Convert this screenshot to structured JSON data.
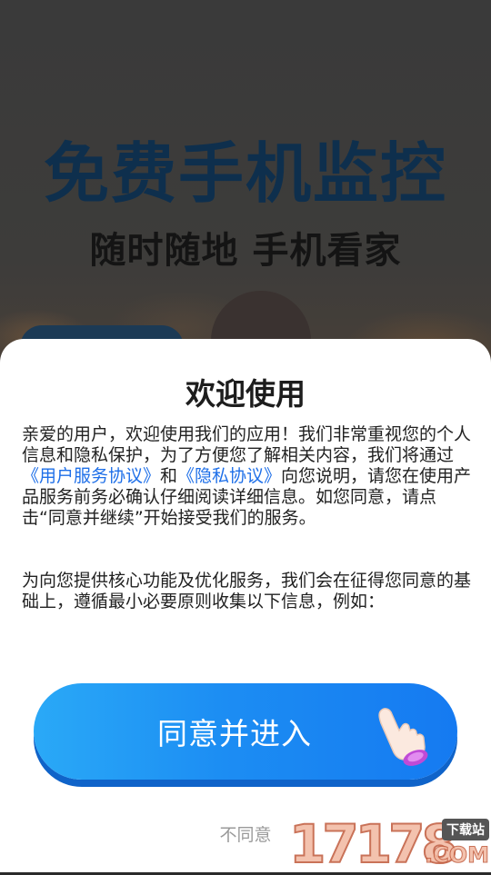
{
  "splash": {
    "title": "免费手机监控",
    "subtitle": "随时随地 手机看家"
  },
  "dialog": {
    "title": "欢迎使用",
    "paragraph1": {
      "text_before": "亲爱的用户，欢迎使用我们的应用！我们非常重视您的个人信息和隐私保护，为了方便您了解相关内容，我们将通过",
      "link_user_agreement": "《用户服务协议》",
      "text_and": "和",
      "link_privacy": "《隐私协议》",
      "text_after": "向您说明，请您在使用产品服务前务必确认仔细阅读详细信息。如您同意，请点击“同意并继续”开始接受我们的服务。"
    },
    "paragraph2": "为向您提供核心功能及优化服务，我们会在征得您同意的基础上，遵循最小必要原则收集以下信息，例如：",
    "agree_label": "同意并进入",
    "disagree_label": "不同意"
  },
  "watermark": {
    "number": "17178",
    "tag": "下载站",
    "suffix": ".COM"
  },
  "colors": {
    "primary_blue": "#1c8df3",
    "link_blue": "#1e6fe8",
    "dialog_bg": "#ffffff",
    "muted_text": "#9a9a9a"
  },
  "icons": {
    "agree_button_icon": "pointing-hand-icon"
  }
}
